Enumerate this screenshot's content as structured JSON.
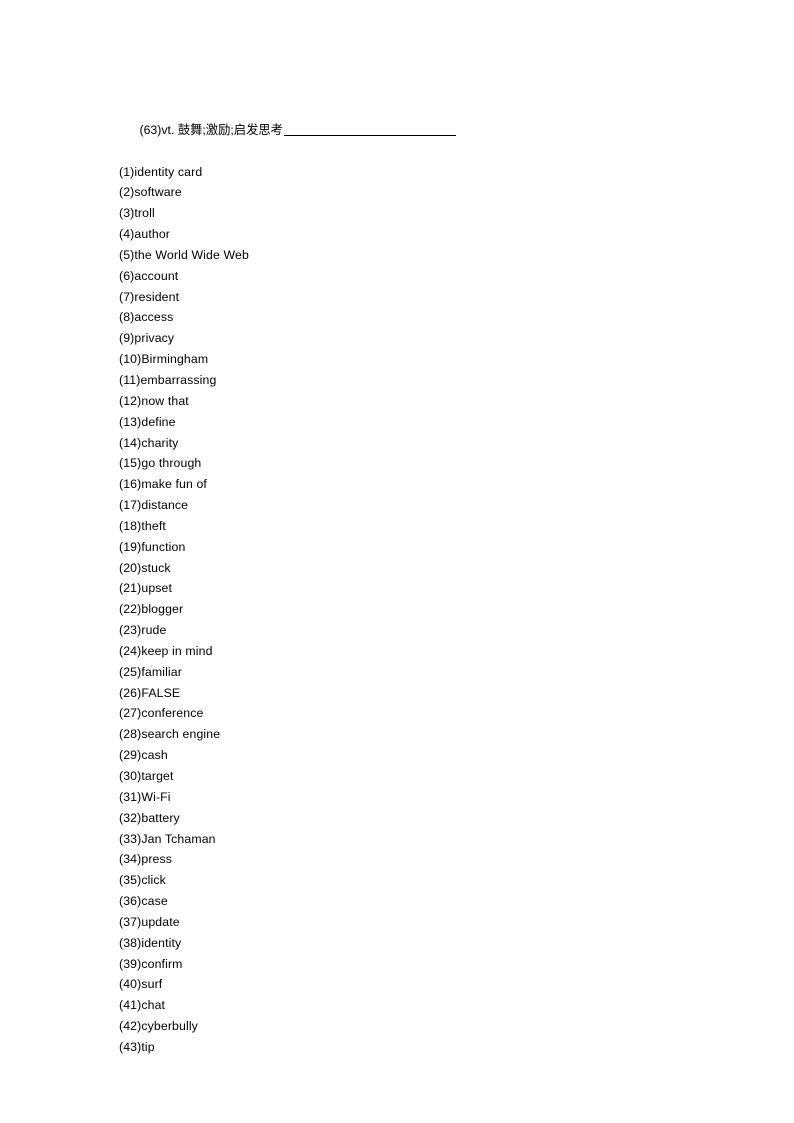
{
  "document": {
    "heading": {
      "number": "(63)",
      "pos": "vt.",
      "gloss": "鼓舞;激励;启发思考",
      "full_text": "(63)vt. 鼓舞;激励;启发思考",
      "has_blank_rule": true
    },
    "entries": [
      {
        "number": "(1)",
        "term": "identity card",
        "text": "(1)identity card"
      },
      {
        "number": "(2)",
        "term": "software",
        "text": "(2)software"
      },
      {
        "number": "(3)",
        "term": "troll",
        "text": "(3)troll"
      },
      {
        "number": "(4)",
        "term": "author",
        "text": "(4)author"
      },
      {
        "number": "(5)",
        "term": "the World Wide Web",
        "text": "(5)the World Wide Web"
      },
      {
        "number": "(6)",
        "term": "account",
        "text": "(6)account"
      },
      {
        "number": "(7)",
        "term": "resident",
        "text": "(7)resident"
      },
      {
        "number": "(8)",
        "term": "access",
        "text": "(8)access"
      },
      {
        "number": "(9)",
        "term": "privacy",
        "text": "(9)privacy"
      },
      {
        "number": "(10)",
        "term": "Birmingham",
        "text": "(10)Birmingham"
      },
      {
        "number": "(11)",
        "term": "embarrassing",
        "text": "(11)embarrassing"
      },
      {
        "number": "(12)",
        "term": "now that",
        "text": "(12)now that"
      },
      {
        "number": "(13)",
        "term": "define",
        "text": "(13)define"
      },
      {
        "number": "(14)",
        "term": "charity",
        "text": "(14)charity"
      },
      {
        "number": "(15)",
        "term": "go through",
        "text": "(15)go through"
      },
      {
        "number": "(16)",
        "term": "make fun of",
        "text": "(16)make fun of"
      },
      {
        "number": "(17)",
        "term": "distance",
        "text": "(17)distance"
      },
      {
        "number": "(18)",
        "term": "theft",
        "text": "(18)theft"
      },
      {
        "number": "(19)",
        "term": "function",
        "text": "(19)function"
      },
      {
        "number": "(20)",
        "term": "stuck",
        "text": "(20)stuck"
      },
      {
        "number": "(21)",
        "term": "upset",
        "text": "(21)upset"
      },
      {
        "number": "(22)",
        "term": "blogger",
        "text": "(22)blogger"
      },
      {
        "number": "(23)",
        "term": "rude",
        "text": "(23)rude"
      },
      {
        "number": "(24)",
        "term": "keep in mind",
        "text": "(24)keep in mind"
      },
      {
        "number": "(25)",
        "term": "familiar",
        "text": "(25)familiar"
      },
      {
        "number": "(26)",
        "term": "FALSE",
        "text": "(26)FALSE"
      },
      {
        "number": "(27)",
        "term": "conference",
        "text": "(27)conference"
      },
      {
        "number": "(28)",
        "term": "search engine",
        "text": "(28)search engine"
      },
      {
        "number": "(29)",
        "term": "cash",
        "text": "(29)cash"
      },
      {
        "number": "(30)",
        "term": "target",
        "text": "(30)target"
      },
      {
        "number": "(31)",
        "term": "Wi-Fi",
        "text": "(31)Wi-Fi"
      },
      {
        "number": "(32)",
        "term": "battery",
        "text": "(32)battery"
      },
      {
        "number": "(33)",
        "term": "Jan Tchaman",
        "text": "(33)Jan Tchaman"
      },
      {
        "number": "(34)",
        "term": "press",
        "text": "(34)press"
      },
      {
        "number": "(35)",
        "term": "click",
        "text": "(35)click"
      },
      {
        "number": "(36)",
        "term": "case",
        "text": "(36)case"
      },
      {
        "number": "(37)",
        "term": "update",
        "text": "(37)update"
      },
      {
        "number": "(38)",
        "term": "identity",
        "text": "(38)identity"
      },
      {
        "number": "(39)",
        "term": "confirm",
        "text": "(39)confirm"
      },
      {
        "number": "(40)",
        "term": "surf",
        "text": "(40)surf"
      },
      {
        "number": "(41)",
        "term": "chat",
        "text": "(41)chat"
      },
      {
        "number": "(42)",
        "term": "cyberbully",
        "text": "(42)cyberbully"
      },
      {
        "number": "(43)",
        "term": "tip",
        "text": "(43)tip"
      }
    ]
  }
}
